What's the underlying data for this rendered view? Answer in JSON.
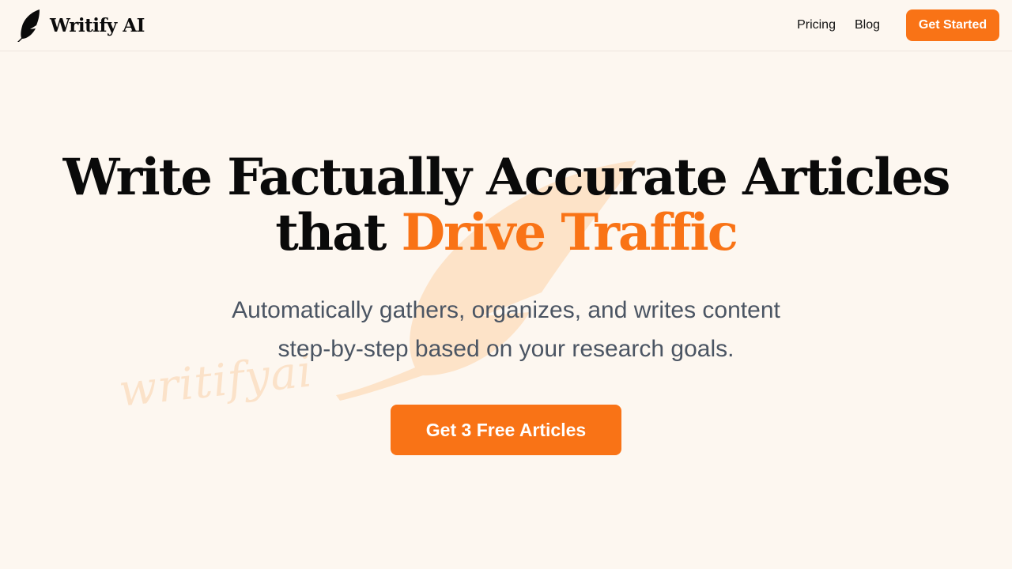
{
  "brand": {
    "name": "Writify AI",
    "logo_icon": "feather-icon"
  },
  "nav": {
    "links": [
      {
        "label": "Pricing"
      },
      {
        "label": "Blog"
      }
    ],
    "cta_label": "Get Started"
  },
  "hero": {
    "title_line1": "Write Factually Accurate Articles",
    "title_line2_prefix": "that",
    "title_line2_accent": "Drive Traffic",
    "subtitle": "Automatically gathers, organizes, and writes content step-by-step based on your research goals.",
    "cta_label": "Get 3 Free Articles",
    "watermark_text": "writifyai"
  },
  "colors": {
    "accent": "#f97316",
    "background": "#fdf7f0",
    "text_dark": "#0a0a0a",
    "text_muted": "#4b5563",
    "watermark": "#fbe2c9"
  }
}
